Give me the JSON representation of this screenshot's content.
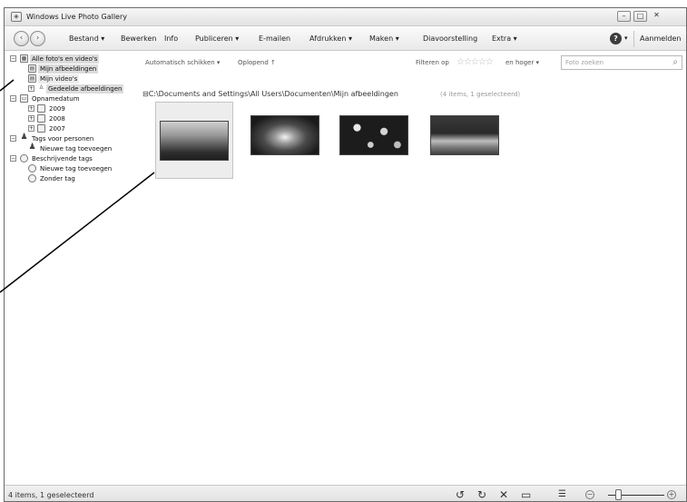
{
  "window": {
    "title": "Windows Live Photo Gallery"
  },
  "menu": {
    "items": [
      {
        "label": "Bestand"
      },
      {
        "label": "Bewerken"
      },
      {
        "label": "Info"
      },
      {
        "label": "Publiceren"
      },
      {
        "label": "E-mailen"
      },
      {
        "label": "Afdrukken"
      },
      {
        "label": "Maken"
      },
      {
        "label": "Diavoorstelling"
      },
      {
        "label": "Extra"
      }
    ],
    "sign_in": "Aanmelden"
  },
  "sidebar": {
    "all": "Alle foto's en video's",
    "my_pictures": "Mijn afbeeldingen",
    "my_videos": "Mijn video's",
    "shared_pictures": "Gedeelde afbeeldingen",
    "date_taken": "Opnamedatum",
    "years": [
      "2009",
      "2008",
      "2007"
    ],
    "people_tags": "Tags voor personen",
    "add_people_tag": "Nieuwe tag toevoegen",
    "descriptive_tags": "Beschrijvende tags",
    "add_desc_tag": "Nieuwe tag toevoegen",
    "untagged": "Zonder tag"
  },
  "toolbar": {
    "arrange": "Automatisch schikken",
    "sort": "Oplopend",
    "filter": "Filteren op",
    "rating_filter": "en hoger",
    "search_placeholder": "Foto zoeken"
  },
  "content": {
    "path": "C:\\Documents and Settings\\All Users\\Documenten\\Mijn afbeeldingen",
    "count": "(4 items, 1 geselecteerd)"
  },
  "status": {
    "text": "4 items, 1 geselecteerd"
  },
  "icons": {
    "app": "photo-gallery-icon",
    "help": "help-icon",
    "search": "search-icon",
    "rotate_left": "rotate-left-icon",
    "rotate_right": "rotate-right-icon",
    "delete": "delete-icon",
    "slideshow": "slideshow-icon",
    "view": "view-details-icon"
  }
}
